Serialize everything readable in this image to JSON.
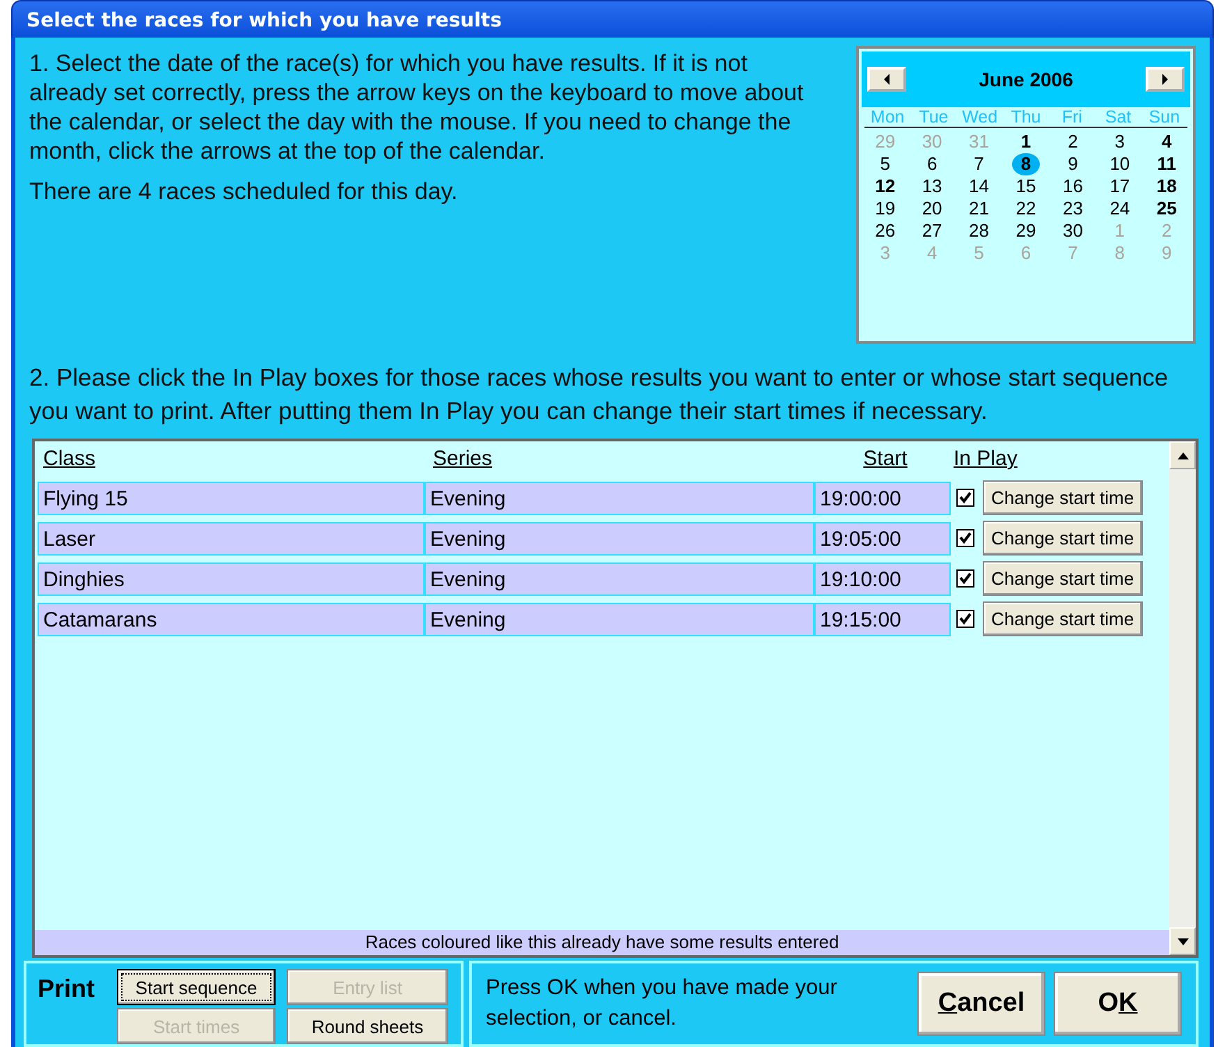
{
  "window": {
    "title": "Select the races for which you have results"
  },
  "step1": {
    "paragraphs": [
      "1.  Select the date of the race(s) for which you have results. If it is not already set correctly, press the arrow keys on the keyboard to move about the calendar, or select the day with the mouse.  If you need to change the month, click the arrows at the top of the calendar.",
      "There are 4 races scheduled for this day."
    ]
  },
  "calendar": {
    "month": "June 2006",
    "weekdays": [
      "Mon",
      "Tue",
      "Wed",
      "Thu",
      "Fri",
      "Sat",
      "Sun"
    ],
    "days": [
      {
        "label": "29",
        "muted": true,
        "bold": false,
        "selected": false
      },
      {
        "label": "30",
        "muted": true,
        "bold": false,
        "selected": false
      },
      {
        "label": "31",
        "muted": true,
        "bold": false,
        "selected": false
      },
      {
        "label": "1",
        "muted": false,
        "bold": true,
        "selected": false
      },
      {
        "label": "2",
        "muted": false,
        "bold": false,
        "selected": false
      },
      {
        "label": "3",
        "muted": false,
        "bold": false,
        "selected": false
      },
      {
        "label": "4",
        "muted": false,
        "bold": true,
        "selected": false
      },
      {
        "label": "5",
        "muted": false,
        "bold": false,
        "selected": false
      },
      {
        "label": "6",
        "muted": false,
        "bold": false,
        "selected": false
      },
      {
        "label": "7",
        "muted": false,
        "bold": false,
        "selected": false
      },
      {
        "label": "8",
        "muted": false,
        "bold": true,
        "selected": true
      },
      {
        "label": "9",
        "muted": false,
        "bold": false,
        "selected": false
      },
      {
        "label": "10",
        "muted": false,
        "bold": false,
        "selected": false
      },
      {
        "label": "11",
        "muted": false,
        "bold": true,
        "selected": false
      },
      {
        "label": "12",
        "muted": false,
        "bold": true,
        "selected": false
      },
      {
        "label": "13",
        "muted": false,
        "bold": false,
        "selected": false
      },
      {
        "label": "14",
        "muted": false,
        "bold": false,
        "selected": false
      },
      {
        "label": "15",
        "muted": false,
        "bold": false,
        "selected": false
      },
      {
        "label": "16",
        "muted": false,
        "bold": false,
        "selected": false
      },
      {
        "label": "17",
        "muted": false,
        "bold": false,
        "selected": false
      },
      {
        "label": "18",
        "muted": false,
        "bold": true,
        "selected": false
      },
      {
        "label": "19",
        "muted": false,
        "bold": false,
        "selected": false
      },
      {
        "label": "20",
        "muted": false,
        "bold": false,
        "selected": false
      },
      {
        "label": "21",
        "muted": false,
        "bold": false,
        "selected": false
      },
      {
        "label": "22",
        "muted": false,
        "bold": false,
        "selected": false
      },
      {
        "label": "23",
        "muted": false,
        "bold": false,
        "selected": false
      },
      {
        "label": "24",
        "muted": false,
        "bold": false,
        "selected": false
      },
      {
        "label": "25",
        "muted": false,
        "bold": true,
        "selected": false
      },
      {
        "label": "26",
        "muted": false,
        "bold": false,
        "selected": false
      },
      {
        "label": "27",
        "muted": false,
        "bold": false,
        "selected": false
      },
      {
        "label": "28",
        "muted": false,
        "bold": false,
        "selected": false
      },
      {
        "label": "29",
        "muted": false,
        "bold": false,
        "selected": false
      },
      {
        "label": "30",
        "muted": false,
        "bold": false,
        "selected": false
      },
      {
        "label": "1",
        "muted": true,
        "bold": false,
        "selected": false
      },
      {
        "label": "2",
        "muted": true,
        "bold": false,
        "selected": false
      },
      {
        "label": "3",
        "muted": true,
        "bold": false,
        "selected": false
      },
      {
        "label": "4",
        "muted": true,
        "bold": false,
        "selected": false
      },
      {
        "label": "5",
        "muted": true,
        "bold": false,
        "selected": false
      },
      {
        "label": "6",
        "muted": true,
        "bold": false,
        "selected": false
      },
      {
        "label": "7",
        "muted": true,
        "bold": false,
        "selected": false
      },
      {
        "label": "8",
        "muted": true,
        "bold": false,
        "selected": false
      },
      {
        "label": "9",
        "muted": true,
        "bold": false,
        "selected": false
      }
    ]
  },
  "step2": {
    "text": "2. Please click the In Play boxes for those races whose results you want to enter or whose start sequence you want to print. After putting them In Play you can change their start times if necessary."
  },
  "table": {
    "columns": [
      "Class",
      "Series",
      "Start",
      "In Play"
    ],
    "rows": [
      {
        "class": "Flying 15",
        "series": "Evening",
        "start": "19:00:00",
        "in_play": true,
        "button": "Change start time"
      },
      {
        "class": "Laser",
        "series": "Evening",
        "start": "19:05:00",
        "in_play": true,
        "button": "Change start time"
      },
      {
        "class": "Dinghies",
        "series": "Evening",
        "start": "19:10:00",
        "in_play": true,
        "button": "Change start time"
      },
      {
        "class": "Catamarans",
        "series": "Evening",
        "start": "19:15:00",
        "in_play": true,
        "button": "Change start time"
      }
    ],
    "legend": "Races coloured like this already have some results entered"
  },
  "print": {
    "label": "Print",
    "buttons": [
      {
        "label": "Start sequence",
        "disabled": false,
        "focused": true
      },
      {
        "label": "Entry list",
        "disabled": true,
        "focused": false
      },
      {
        "label": "Start times",
        "disabled": true,
        "focused": false
      },
      {
        "label": "Round sheets",
        "disabled": false,
        "focused": false
      }
    ]
  },
  "footer": {
    "message": "Press OK when you have made your selection, or cancel.",
    "buttons": [
      {
        "key": "C",
        "after": "ancel"
      },
      {
        "before": "O",
        "key": "K"
      }
    ]
  }
}
